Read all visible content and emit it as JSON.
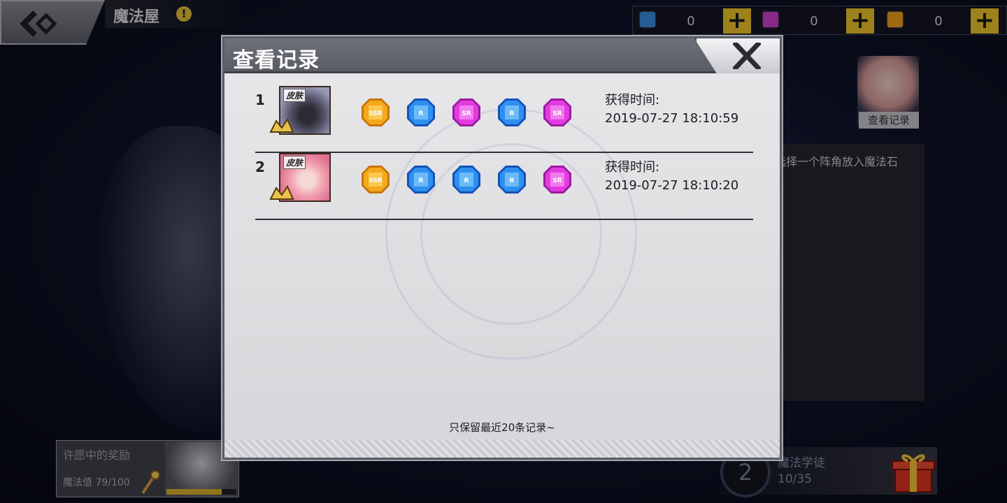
{
  "header": {
    "page_title": "魔法屋",
    "alert": "!"
  },
  "currencies": [
    {
      "name": "blue-gem",
      "value": "0",
      "color": "#3a8fe0"
    },
    {
      "name": "purple-gem",
      "value": "0",
      "color": "#d03fd0"
    },
    {
      "name": "gold-gem",
      "value": "0",
      "color": "#f0a020"
    }
  ],
  "currency_plus": "+",
  "right_panel": {
    "record_button": "查看记录",
    "hint": "请选择一个阵角放入魔法石"
  },
  "reward_panel": {
    "title": "许愿中的奖励",
    "mana": "魔法值 79/100",
    "mana_fraction": 0.79
  },
  "level_panel": {
    "level": "2",
    "name": "魔法学徒",
    "progress": "10/35"
  },
  "modal": {
    "title": "查看记录",
    "time_label": "获得时间:",
    "skin_tag": "皮肤",
    "footnote": "只保留最近20条记录~",
    "records": [
      {
        "index": "1",
        "portrait": "dark",
        "gems": [
          {
            "rarity": "SSR",
            "color": "gold"
          },
          {
            "rarity": "R",
            "color": "blue"
          },
          {
            "rarity": "SR",
            "color": "pink"
          },
          {
            "rarity": "R",
            "color": "blue"
          },
          {
            "rarity": "SR",
            "color": "pink"
          }
        ],
        "time": "2019-07-27 18:10:59"
      },
      {
        "index": "2",
        "portrait": "pink",
        "gems": [
          {
            "rarity": "SSR",
            "color": "gold"
          },
          {
            "rarity": "R",
            "color": "blue"
          },
          {
            "rarity": "R",
            "color": "blue"
          },
          {
            "rarity": "R",
            "color": "blue"
          },
          {
            "rarity": "SR",
            "color": "pink"
          }
        ],
        "time": "2019-07-27 18:10:20"
      }
    ]
  },
  "gem_colors": {
    "gold": [
      "#ffe27a",
      "#f4a81c",
      "#c9740a"
    ],
    "blue": [
      "#9fe0ff",
      "#2f8ff0",
      "#1452b8"
    ],
    "pink": [
      "#ffb3f7",
      "#e23be0",
      "#9a1ba0"
    ]
  }
}
